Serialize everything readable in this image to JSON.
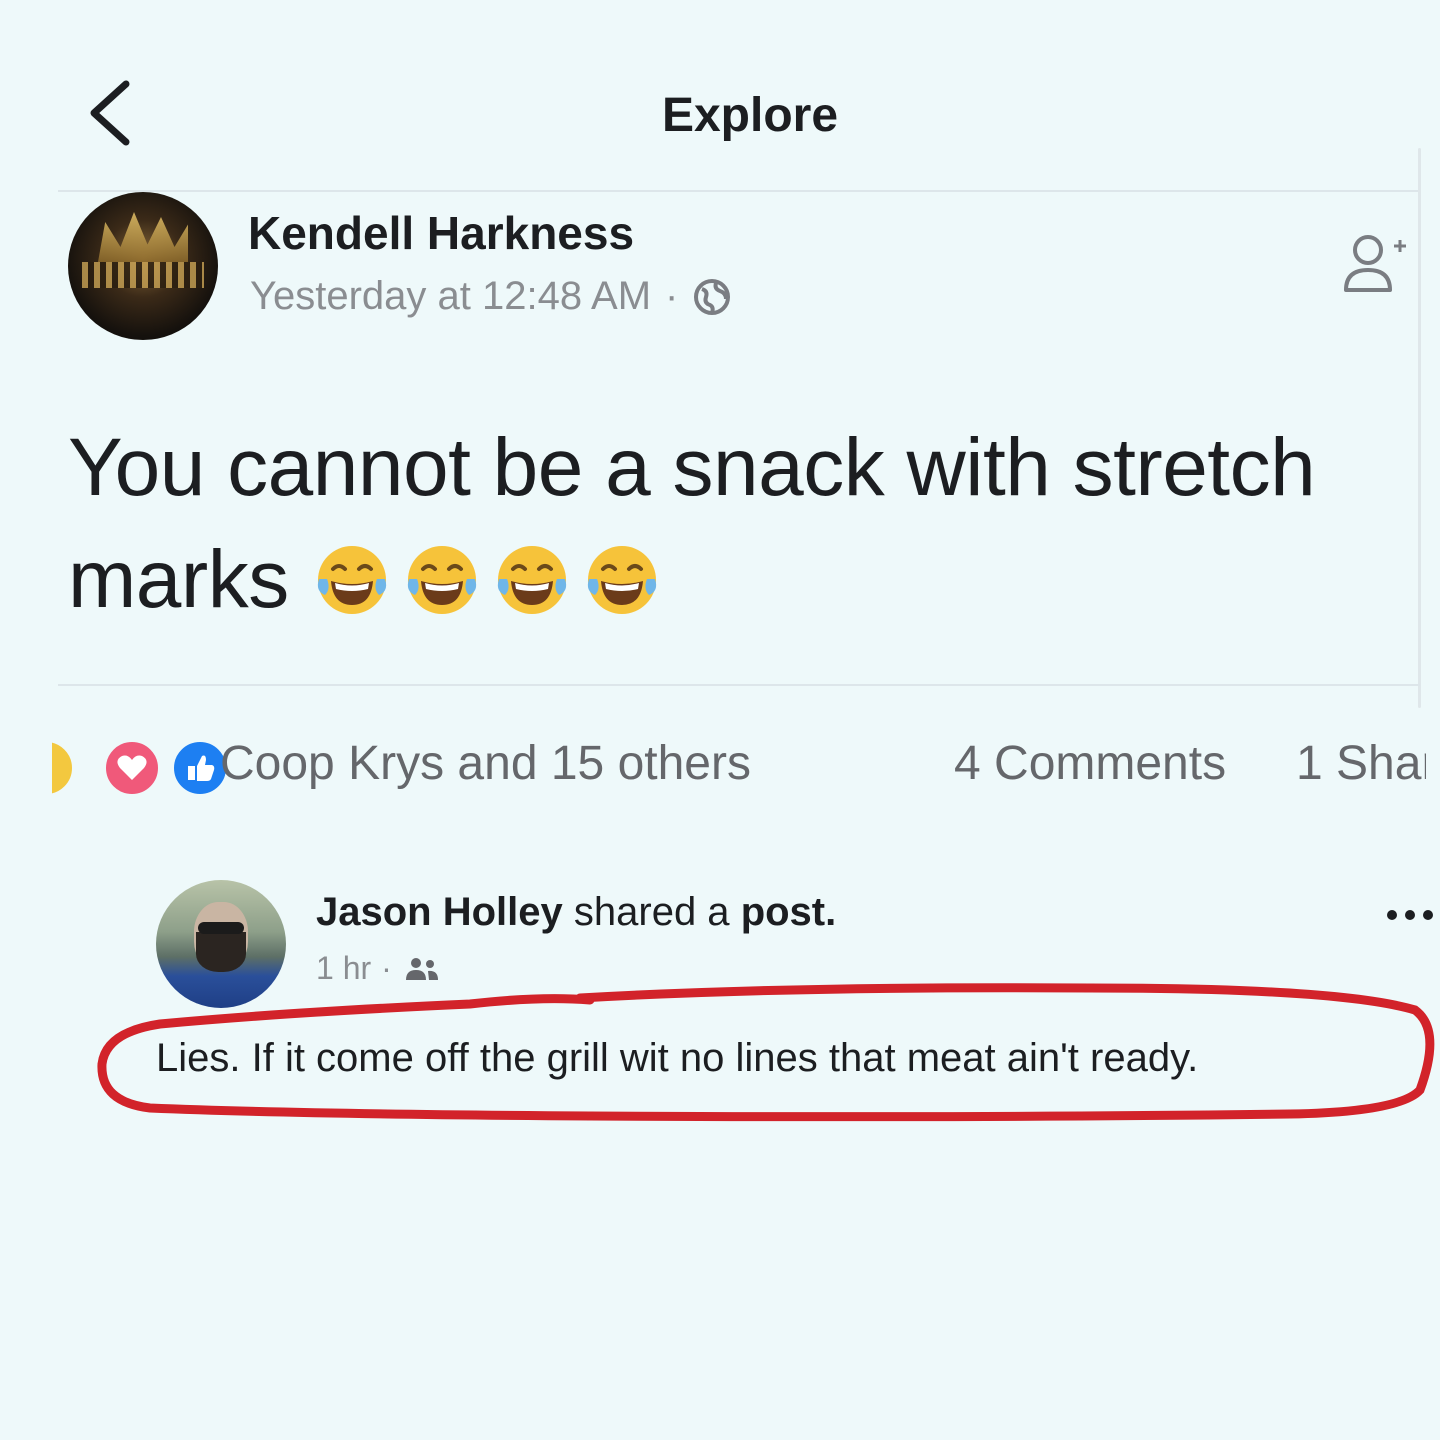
{
  "header": {
    "title": "Explore"
  },
  "post": {
    "author": "Kendell Harkness",
    "timestamp": "Yesterday at 12:48 AM",
    "separator": "·",
    "text": "You cannot be a snack with stretch marks",
    "emojis": [
      "face-with-tears-of-joy",
      "face-with-tears-of-joy",
      "face-with-tears-of-joy",
      "face-with-tears-of-joy"
    ],
    "reactions": {
      "types": [
        "haha",
        "love",
        "like"
      ],
      "names": "Coop Krys and 15 others"
    },
    "comments": "4 Comments",
    "shares": "1 Shar"
  },
  "shared_post": {
    "author": "Jason Holley",
    "action_prefix": "shared a",
    "action_object": "post.",
    "time": "1 hr",
    "separator": "·",
    "text": "Lies. If it come off the grill wit no lines that meat ain't ready."
  },
  "colors": {
    "background": "#eef9fa",
    "annotation": "#d2232a",
    "like_blue": "#1d7ff2",
    "love_pink": "#f0597a",
    "haha_yellow": "#f3c83f"
  }
}
